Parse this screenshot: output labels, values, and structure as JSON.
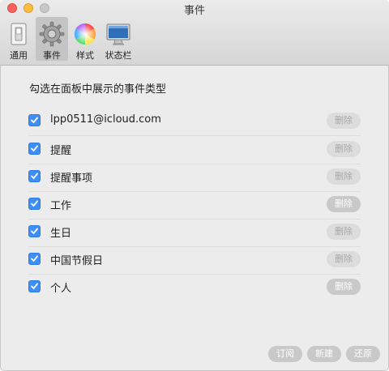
{
  "window": {
    "title": "事件"
  },
  "toolbar": {
    "items": [
      {
        "label": "通用",
        "icon": "switch-icon",
        "selected": false
      },
      {
        "label": "事件",
        "icon": "gear-icon",
        "selected": true
      },
      {
        "label": "样式",
        "icon": "color-wheel-icon",
        "selected": false
      },
      {
        "label": "状态栏",
        "icon": "imac-icon",
        "selected": false
      }
    ]
  },
  "main": {
    "heading": "勾选在面板中展示的事件类型",
    "event_types": [
      {
        "label": "lpp0511@icloud.com",
        "checked": true,
        "delete_label": "删除",
        "delete_enabled": false
      },
      {
        "label": "提醒",
        "checked": true,
        "delete_label": "删除",
        "delete_enabled": false
      },
      {
        "label": "提醒事项",
        "checked": true,
        "delete_label": "删除",
        "delete_enabled": false
      },
      {
        "label": "工作",
        "checked": true,
        "delete_label": "删除",
        "delete_enabled": true
      },
      {
        "label": "生日",
        "checked": true,
        "delete_label": "删除",
        "delete_enabled": false
      },
      {
        "label": "中国节假日",
        "checked": true,
        "delete_label": "删除",
        "delete_enabled": false
      },
      {
        "label": "个人",
        "checked": true,
        "delete_label": "删除",
        "delete_enabled": true
      }
    ]
  },
  "footer": {
    "subscribe_label": "订阅",
    "new_label": "新建",
    "restore_label": "还原"
  },
  "colors": {
    "checkbox": "#3d8ff5",
    "button_active": "#c9c9c9",
    "button_disabled": "#dcdcdc"
  }
}
